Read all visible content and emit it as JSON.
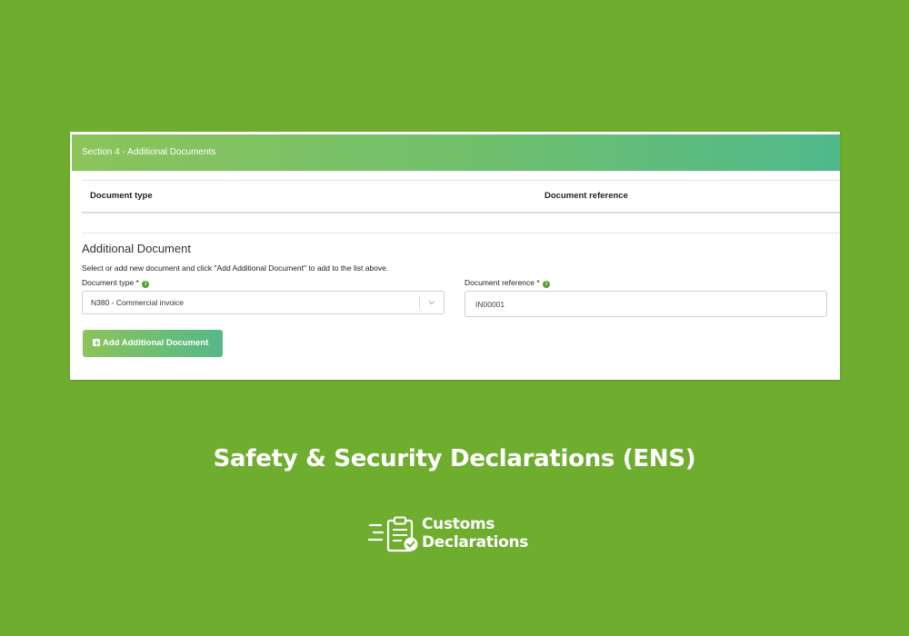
{
  "form": {
    "section_title": "Section 4 - Additional Documents",
    "table_headers": {
      "document_type": "Document type",
      "document_reference": "Document reference"
    },
    "subsection_title": "Additional Document",
    "help_text": "Select or add new document and click \"Add Additional Document\" to add to the list above.",
    "document_type_label": "Document type *",
    "document_type_value": "N380 - Commercial invoice",
    "document_reference_label": "Document reference *",
    "document_reference_value": "IN00001",
    "add_button_label": "Add Additional Document"
  },
  "caption": "Safety & Security Declarations (ENS)",
  "brand": {
    "line1": "Customs",
    "line2": "Declarations"
  },
  "colors": {
    "background": "#6fad2f",
    "header_gradient_start": "#8bc45a",
    "header_gradient_end": "#4fb98c",
    "info_icon": "#5aa02c"
  }
}
